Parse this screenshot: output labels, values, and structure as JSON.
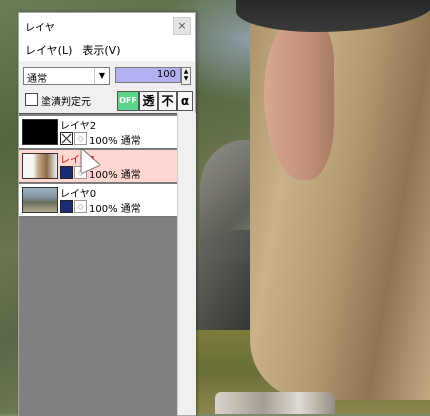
{
  "window": {
    "title": "レイヤ",
    "close": "×"
  },
  "menu": {
    "items": [
      "レイヤ(L)",
      "表示(V)"
    ]
  },
  "blend_mode": {
    "value": "通常"
  },
  "opacity": {
    "value": "100"
  },
  "clip_checkbox": {
    "label": "塗潰判定元",
    "checked": false
  },
  "tool_buttons": {
    "off": "OFF",
    "trans": "透",
    "not": "不",
    "alpha": "α"
  },
  "layers": [
    {
      "name": "レイヤ2",
      "visible": false,
      "status": "100% 通常",
      "selected": false
    },
    {
      "name": "レイヤ1",
      "visible": true,
      "status": "100% 通常",
      "selected": true
    },
    {
      "name": "レイヤ0",
      "visible": true,
      "status": "100% 通常",
      "selected": false
    }
  ],
  "colors": {
    "selection": "#ffd6d0",
    "opacity_fill": "#b4b0f4",
    "off_button": "#5ad48a"
  }
}
